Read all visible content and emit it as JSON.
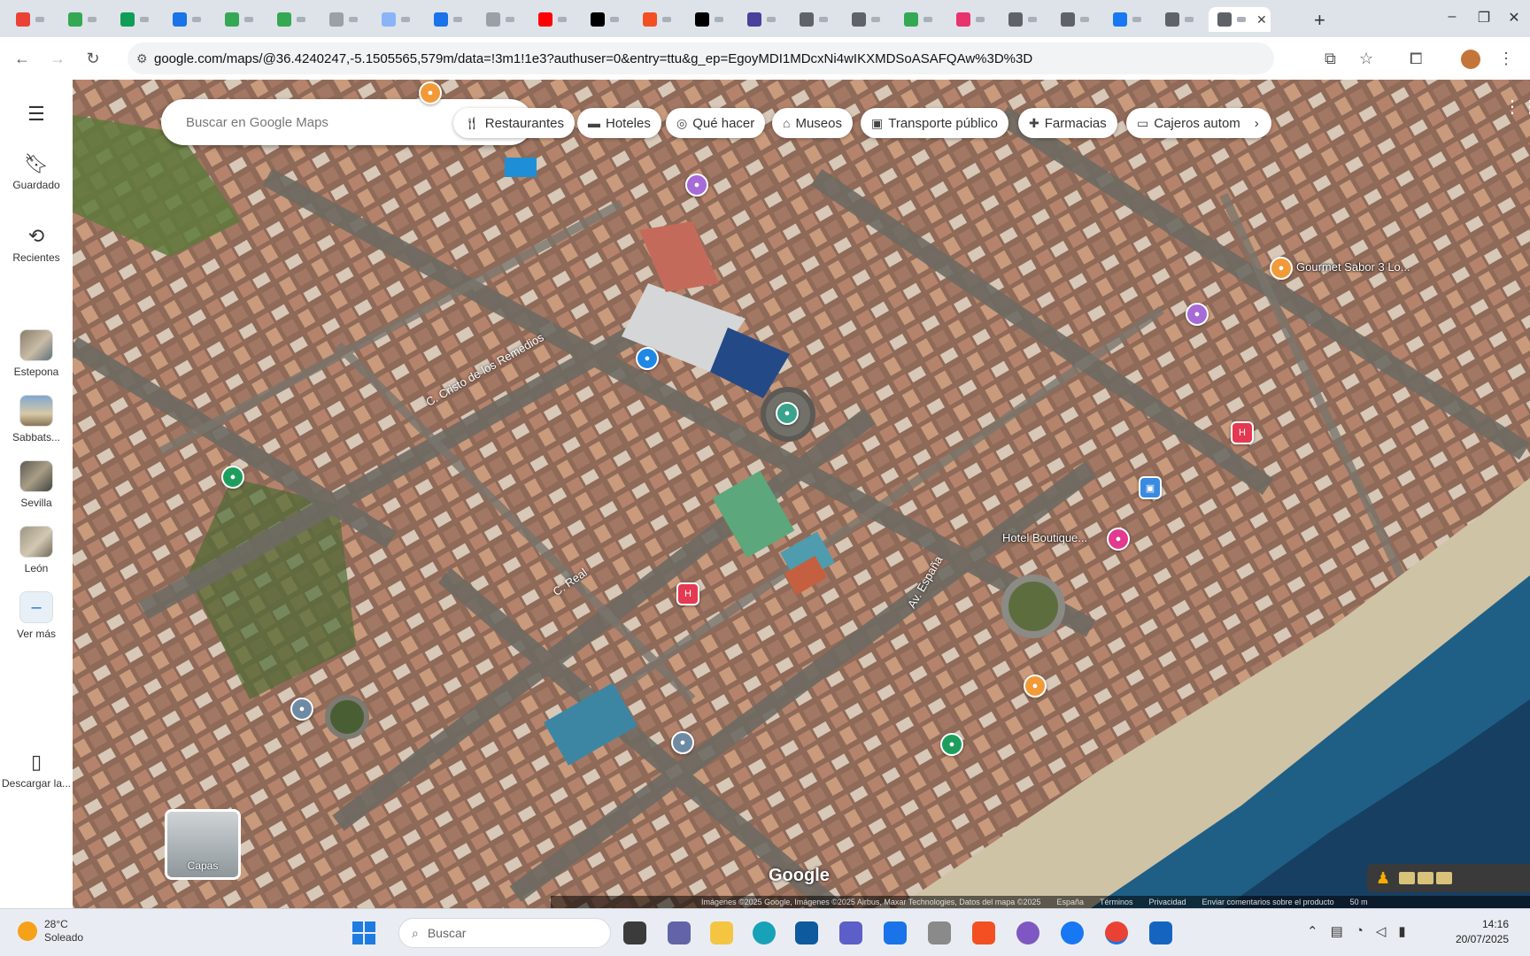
{
  "browser": {
    "tabs": [
      {
        "icon": "gmail-icon",
        "color": "#ea4335"
      },
      {
        "icon": "sheets-icon",
        "color": "#34a853"
      },
      {
        "icon": "sheets-icon",
        "color": "#0f9d58"
      },
      {
        "icon": "docs-icon",
        "color": "#1a73e8"
      },
      {
        "icon": "sheets-icon",
        "color": "#34a853"
      },
      {
        "icon": "sheets-icon",
        "color": "#34a853"
      },
      {
        "icon": "globe-icon",
        "color": "#9aa0a6"
      },
      {
        "icon": "globe-icon",
        "color": "#8ab4f8"
      },
      {
        "icon": "cloud-icon",
        "color": "#1a73e8"
      },
      {
        "icon": "google-icon",
        "color": "#9aa0a6"
      },
      {
        "icon": "youtube-icon",
        "color": "#ff0000"
      },
      {
        "icon": "x-icon",
        "color": "#000000"
      },
      {
        "icon": "microsoft-icon",
        "color": "#f25022"
      },
      {
        "icon": "x-icon",
        "color": "#000000"
      },
      {
        "icon": "shield-icon",
        "color": "#4a3f9a"
      },
      {
        "icon": "sparkle-icon",
        "color": "#5f6368"
      },
      {
        "icon": "sparkle-icon",
        "color": "#5f6368"
      },
      {
        "icon": "chrome-icon",
        "color": "#34a853"
      },
      {
        "icon": "app-icon",
        "color": "#e8336d"
      },
      {
        "icon": "sparkle-icon",
        "color": "#5f6368"
      },
      {
        "icon": "sparkle-icon",
        "color": "#5f6368"
      },
      {
        "icon": "facebook-icon",
        "color": "#1877f2"
      },
      {
        "icon": "sparkle-icon",
        "color": "#5f6368"
      },
      {
        "icon": "sparkle-icon",
        "color": "#5f6368",
        "active": true
      }
    ],
    "url_site": "google.com/maps/@36.4240247,-5.1505565,579m/data=!3m1!1e3?authuser=0&entry=ttu&g_ep=EgoyMDI1MDcxNi4wIKXMDSoASAFQAw%3D%3D"
  },
  "rail": {
    "menu_icon": "hamburger-icon",
    "items": [
      {
        "label": "Guardado",
        "icon": "bookmark-icon"
      },
      {
        "label": "Recientes",
        "icon": "history-icon"
      }
    ],
    "recents": [
      {
        "label": "Estepona"
      },
      {
        "label": "Sabbats..."
      },
      {
        "label": "Sevilla"
      },
      {
        "label": "León"
      },
      {
        "label": "Ver más"
      }
    ],
    "download": {
      "label": "Descargar la...",
      "icon": "phone-icon"
    }
  },
  "map": {
    "search_placeholder": "Buscar en Google Maps",
    "chips": [
      {
        "label": "Restaurantes",
        "icon": "cutlery-icon"
      },
      {
        "label": "Hoteles",
        "icon": "bed-icon"
      },
      {
        "label": "Qué hacer",
        "icon": "camera-icon"
      },
      {
        "label": "Museos",
        "icon": "museum-icon"
      },
      {
        "label": "Transporte público",
        "icon": "bus-icon"
      },
      {
        "label": "Farmacias",
        "icon": "pharmacy-icon"
      },
      {
        "label": "Cajeros autom",
        "icon": "atm-icon"
      }
    ],
    "layers_label": "Capas",
    "pin_labels": [
      "Gourmet Sabor 3 Lo...",
      "Hotel Boutique..."
    ],
    "street_labels": [
      "C. Cristo de los Remedios",
      "C. Real",
      "Av. España"
    ],
    "google_logo": "Google",
    "bottom_bar": [
      "Imágenes ©2025 Google, Imágenes ©2025 Airbus, Maxar Technologies, Datos del mapa ©2025",
      "España",
      "Términos",
      "Privacidad",
      "Enviar comentarios sobre el producto",
      "50 m"
    ],
    "view_3d": "3D",
    "colors": {
      "water": "#1f5f86",
      "beach": "#cfc3a6",
      "roofs": "#a8745c"
    }
  },
  "taskbar": {
    "weather": {
      "temp": "28°C",
      "desc": "Soleado"
    },
    "search_placeholder": "Buscar",
    "clock": {
      "time": "14:16",
      "date": "20/07/2025"
    }
  }
}
